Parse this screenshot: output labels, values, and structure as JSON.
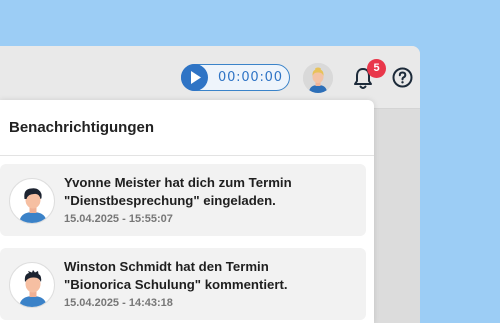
{
  "header": {
    "timer": "00:00:00",
    "notification_count": "5"
  },
  "panel": {
    "title": "Benachrichtigungen"
  },
  "notifications": [
    {
      "line1": "Yvonne Meister hat dich zum Termin",
      "line2": "\"Dienstbesprechung\" eingeladen.",
      "time": "15.04.2025 - 15:55:07",
      "hair_color": "#1c2330"
    },
    {
      "line1": "Winston Schmidt hat den Termin",
      "line2": "\"Bionorica Schulung\" kommentiert.",
      "time": "15.04.2025 - 14:43:18",
      "hair_color": "#1c2330"
    }
  ],
  "colors": {
    "accent": "#2f74c5",
    "badge": "#e9374a",
    "background": "#9ccdf5"
  },
  "icons": [
    "play-icon",
    "bell-icon",
    "help-icon",
    "user-avatar"
  ]
}
